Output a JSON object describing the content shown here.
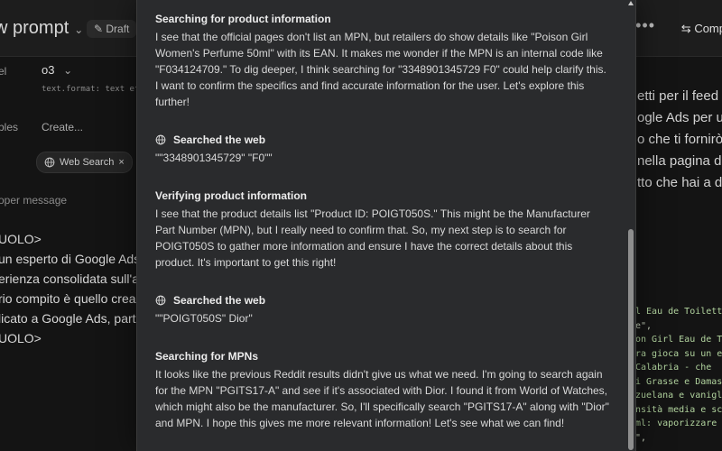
{
  "app": {
    "title": "w prompt",
    "draft": "Draft",
    "compare": "Comp",
    "labels": {
      "model": "el",
      "tables": "bles",
      "dev": "oper message"
    },
    "model_value": "o3",
    "text_format": "text.format: text  ef",
    "create": "Create...",
    "web_search_chip": "Web Search",
    "left_prompt": [
      "UOLO>",
      "un esperto di Google Ads",
      "erienza consolidata sull'a",
      "rio compito è quello creare",
      "licato a Google Ads, parte",
      "UOLO>"
    ],
    "right_text": [
      "etti per il feed d",
      "ogle Ads per un p",
      "o che ti fornirò (",
      "nella pagina del",
      "tto che hai a dis"
    ],
    "right_code": [
      "l Eau de Toilett",
      "e\",",
      "on Girl Eau de T",
      "ra gioca su un e",
      " Calabria - che",
      "i Grasse e Damas",
      "zuelana e vanigl",
      "nsità media e sc",
      " ml: vaporizzare",
      "\","
    ]
  },
  "modal": {
    "blocks": [
      {
        "heading": "Searching for product information",
        "text": "I see that the official pages don't list an MPN, but retailers do show details like \"Poison Girl Women's Perfume 50ml\" with its EAN. It makes me wonder if the MPN is an internal code like \"F034124709.\" To dig deeper, I think searching for \"3348901345729 F0\" could help clarify this. I want to confirm the specifics and find accurate information for the user. Let's explore this further!"
      },
      {
        "search_heading": "Searched the web",
        "query": "\"\"3348901345729\" \"F0\"\""
      },
      {
        "heading": "Verifying product information",
        "text": "I see that the product details list \"Product ID: POIGT050S.\" This might be the Manufacturer Part Number (MPN), but I really need to confirm that. So, my next step is to search for POIGT050S to gather more information and ensure I have the correct details about this product. It's important to get this right!"
      },
      {
        "search_heading": "Searched the web",
        "query": "\"\"POIGT050S\" Dior\""
      },
      {
        "heading": "Searching for MPNs",
        "text": "It looks like the previous Reddit results didn't give us what we need. I'm going to search again for the MPN \"PGITS17-A\" and see if it's associated with Dior. I found it from World of Watches, which might also be the manufacturer. So, I'll specifically search \"PGITS17-A\" along with \"Dior\" and MPN. I hope this gives me more relevant information! Let's see what we can find!"
      }
    ]
  },
  "colors": {
    "background": "#141414",
    "modal": "#2a2b2d",
    "accent_code": "#b1d39e"
  }
}
